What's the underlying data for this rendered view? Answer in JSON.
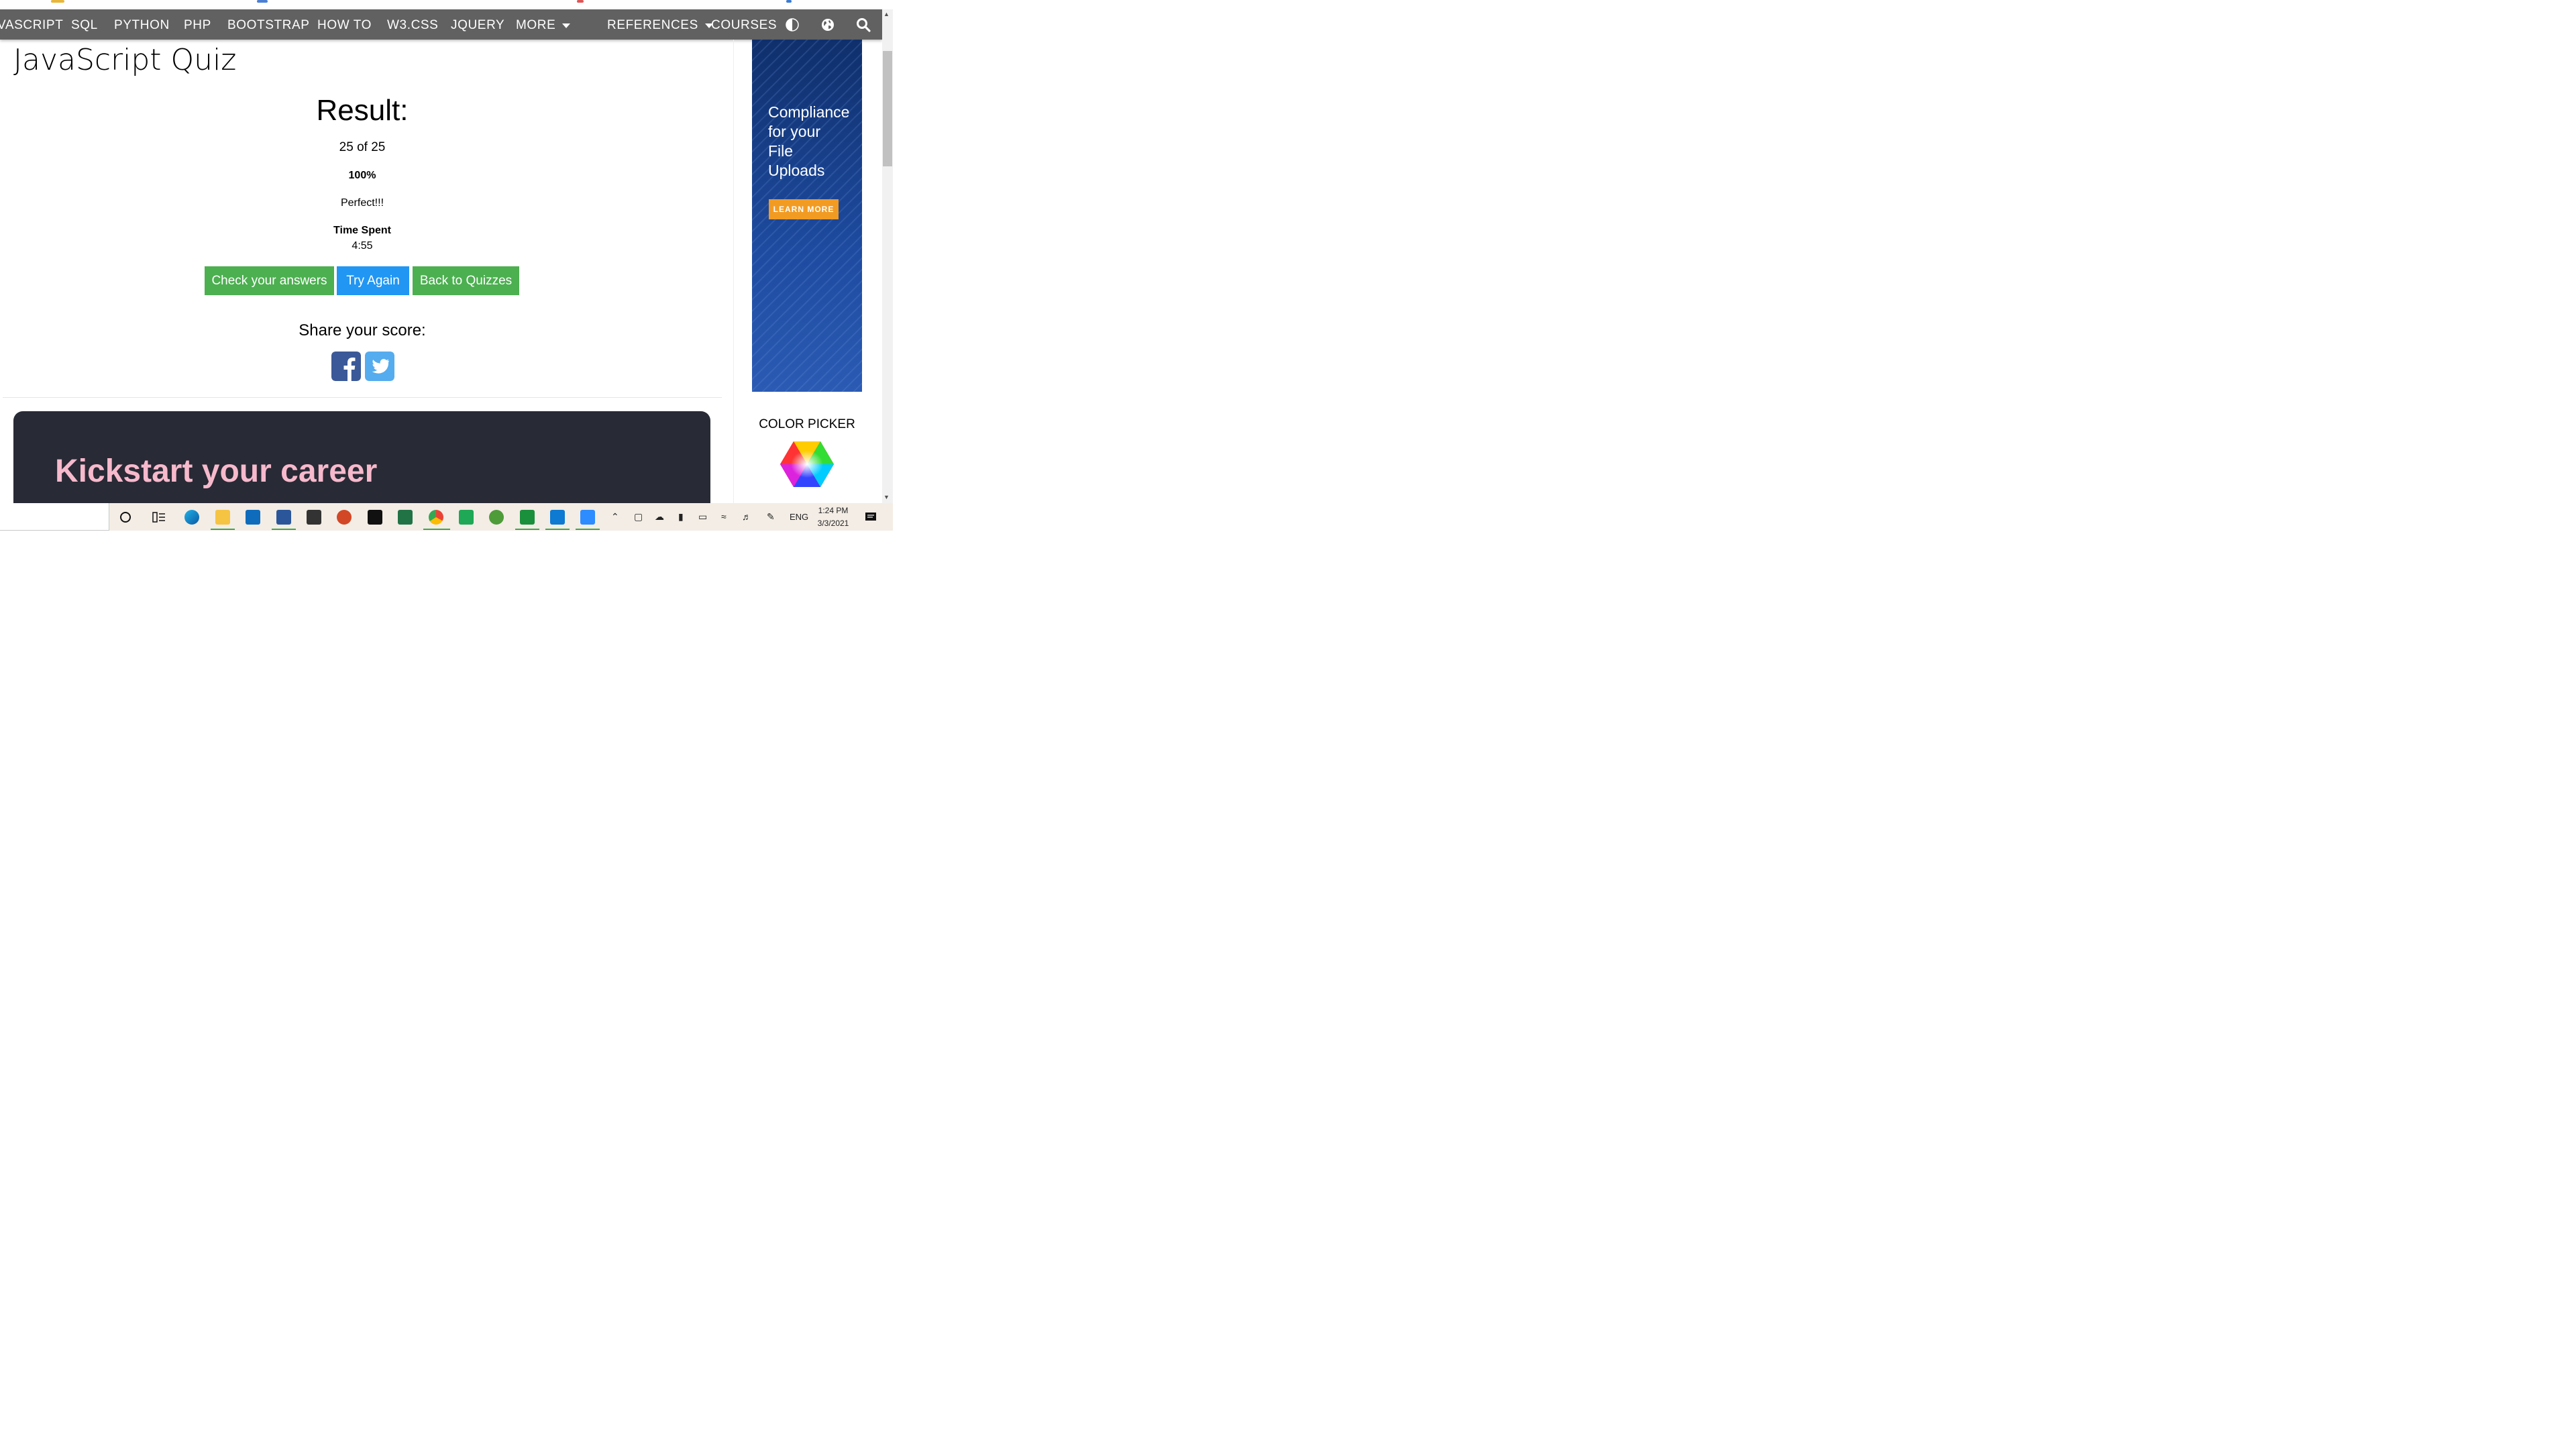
{
  "nav": {
    "items": [
      "VASCRIPT",
      "SQL",
      "PYTHON",
      "PHP",
      "BOOTSTRAP",
      "HOW TO",
      "W3.CSS",
      "JQUERY",
      "MORE",
      "REFERENCES",
      "COURSES"
    ],
    "icons": [
      "contrast-icon",
      "globe-icon",
      "search-icon"
    ]
  },
  "page": {
    "title": "JavaScript Quiz"
  },
  "result": {
    "title": "Result:",
    "score": "25 of 25",
    "percent": "100%",
    "message": "Perfect!!!",
    "time_label": "Time Spent",
    "time_value": "4:55"
  },
  "buttons": {
    "check": "Check your answers",
    "try_again": "Try Again",
    "back": "Back to Quizzes"
  },
  "share": {
    "label": "Share your score:"
  },
  "banner": {
    "title": "Kickstart your career"
  },
  "ad": {
    "lines": [
      "Compliance",
      "for your",
      "File",
      "Uploads"
    ],
    "button": "LEARN MORE"
  },
  "sidebar": {
    "color_picker": "COLOR PICKER"
  },
  "taskbar": {
    "lang": "ENG",
    "time": "1:24 PM",
    "date": "3/3/2021"
  },
  "colors": {
    "nav_bg": "#616161",
    "green": "#4caf50",
    "blue": "#2196f3",
    "banner_bg": "#282a35",
    "banner_title": "#f7b9cc",
    "ad_button": "#f29b23"
  }
}
